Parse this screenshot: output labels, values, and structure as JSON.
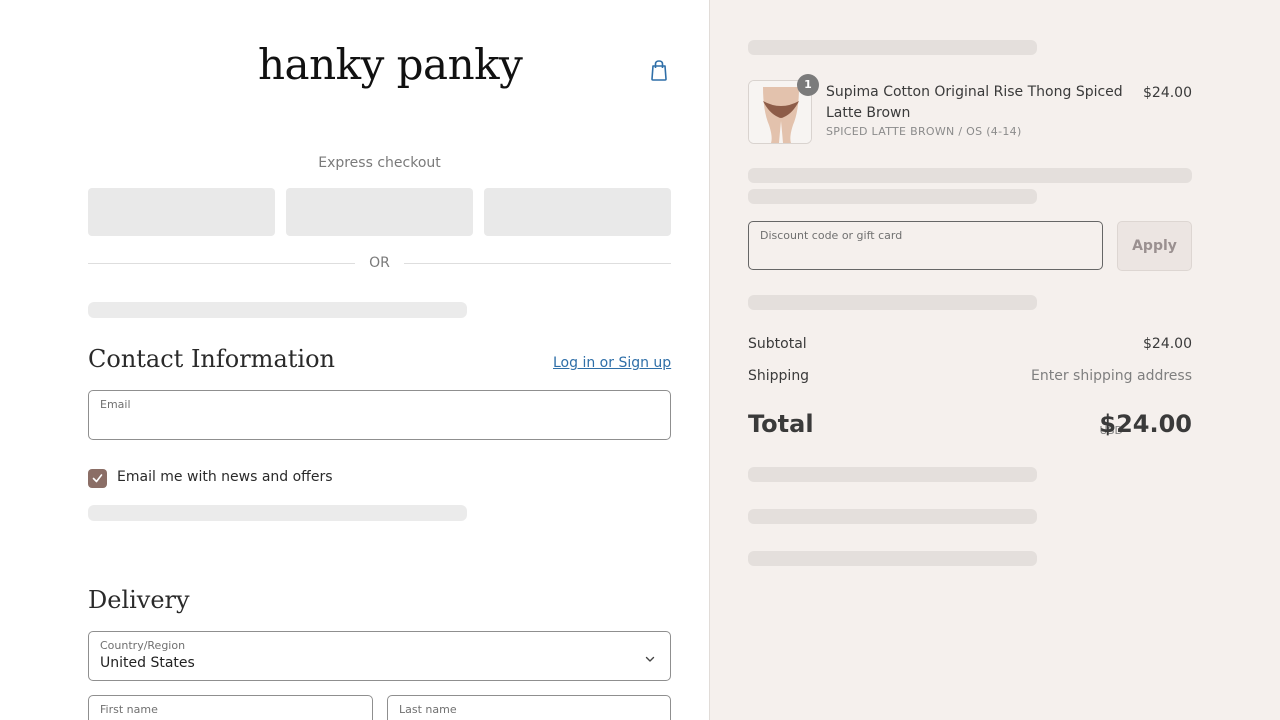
{
  "brand": {
    "logo_text": "hanky panky"
  },
  "header": {
    "cart_icon": "shopping-bag-icon"
  },
  "express": {
    "label": "Express checkout",
    "or_label": "OR"
  },
  "contact": {
    "title": "Contact Information",
    "login_link": "Log in or Sign up",
    "email_label": "Email",
    "email_value": "",
    "newsletter_label": "Email me with news and offers",
    "newsletter_checked": true
  },
  "delivery": {
    "title": "Delivery",
    "country_label": "Country/Region",
    "country_value": "United States",
    "first_name_label": "First name",
    "last_name_label": "Last name"
  },
  "order": {
    "item": {
      "quantity": "1",
      "name": "Supima Cotton Original Rise Thong Spiced Latte Brown",
      "variant": "SPICED LATTE BROWN / OS (4-14)",
      "price": "$24.00"
    },
    "discount_label": "Discount code or gift card",
    "apply_label": "Apply",
    "subtotal_label": "Subtotal",
    "subtotal_value": "$24.00",
    "shipping_label": "Shipping",
    "shipping_value": "Enter shipping address",
    "total_label": "Total",
    "total_currency": "USD",
    "total_value": "$24.00"
  },
  "colors": {
    "accent": "#8b6e66",
    "link": "#2f6fa8",
    "summary_bg": "#f5f0ed"
  }
}
